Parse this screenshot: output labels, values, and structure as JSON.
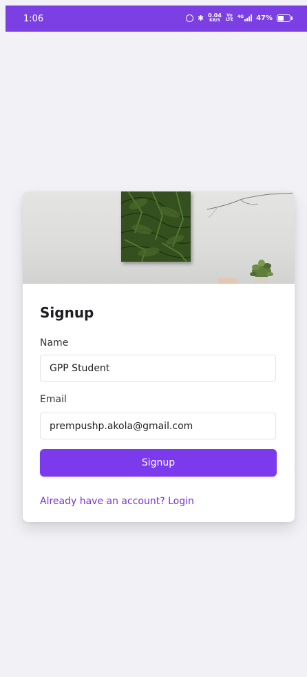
{
  "status_bar": {
    "time": "1:06",
    "net_speed_value": "0.04",
    "net_speed_unit": "KB/S",
    "network_type": "4G",
    "battery_percent": "47%",
    "battery_level": 0.47,
    "color": "#7b3fe4"
  },
  "card": {
    "title": "Signup",
    "name_label": "Name",
    "name_value": "GPP Student",
    "email_label": "Email",
    "email_value": "prempushp.akola@gmail.com",
    "submit_label": "Signup",
    "login_link": "Already have an account? Login",
    "accent_color": "#7c3aed"
  }
}
